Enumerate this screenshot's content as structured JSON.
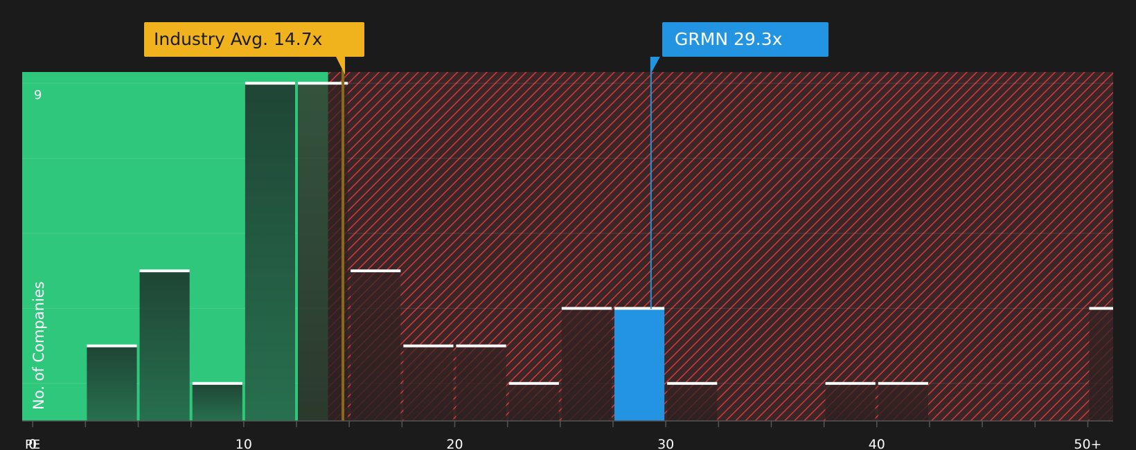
{
  "chart_data": {
    "type": "bar",
    "xlabel": "PE",
    "ylabel": "No. of Companies",
    "xlim": [
      -0.5,
      51.2
    ],
    "ylim": [
      0,
      9.3
    ],
    "y_max_tick": "9",
    "x_ticks": [
      "0",
      "10",
      "20",
      "30",
      "40",
      "50+"
    ],
    "x_tick_values": [
      0,
      10,
      20,
      30,
      40,
      50
    ],
    "bin_width": 2.5,
    "bins": [
      {
        "start": 2.5,
        "count": 2
      },
      {
        "start": 5,
        "count": 4
      },
      {
        "start": 7.5,
        "count": 1
      },
      {
        "start": 10,
        "count": 9
      },
      {
        "start": 12.5,
        "count": 9
      },
      {
        "start": 15,
        "count": 4
      },
      {
        "start": 17.5,
        "count": 2
      },
      {
        "start": 20,
        "count": 2
      },
      {
        "start": 22.5,
        "count": 1
      },
      {
        "start": 25,
        "count": 3
      },
      {
        "start": 27.5,
        "count": 3,
        "highlight": true
      },
      {
        "start": 30,
        "count": 1
      },
      {
        "start": 37.5,
        "count": 1
      },
      {
        "start": 40,
        "count": 1
      },
      {
        "start": 50,
        "count": 3
      }
    ],
    "industry_avg": {
      "value": 14.7,
      "label": "Industry Avg. 14.7x"
    },
    "company": {
      "value": 29.3,
      "label": "GRMN 29.3x"
    },
    "green_zone_end": 14.0,
    "colors": {
      "background": "#1b1b1b",
      "green_zone": "#2ec77c",
      "red_zone": "#3a2626",
      "red_hatch": "#d63a3a",
      "bar_dark": "#214a37",
      "highlight": "#2394e2",
      "industry": "#f0b31d",
      "bar_top": "#ffffff"
    }
  }
}
